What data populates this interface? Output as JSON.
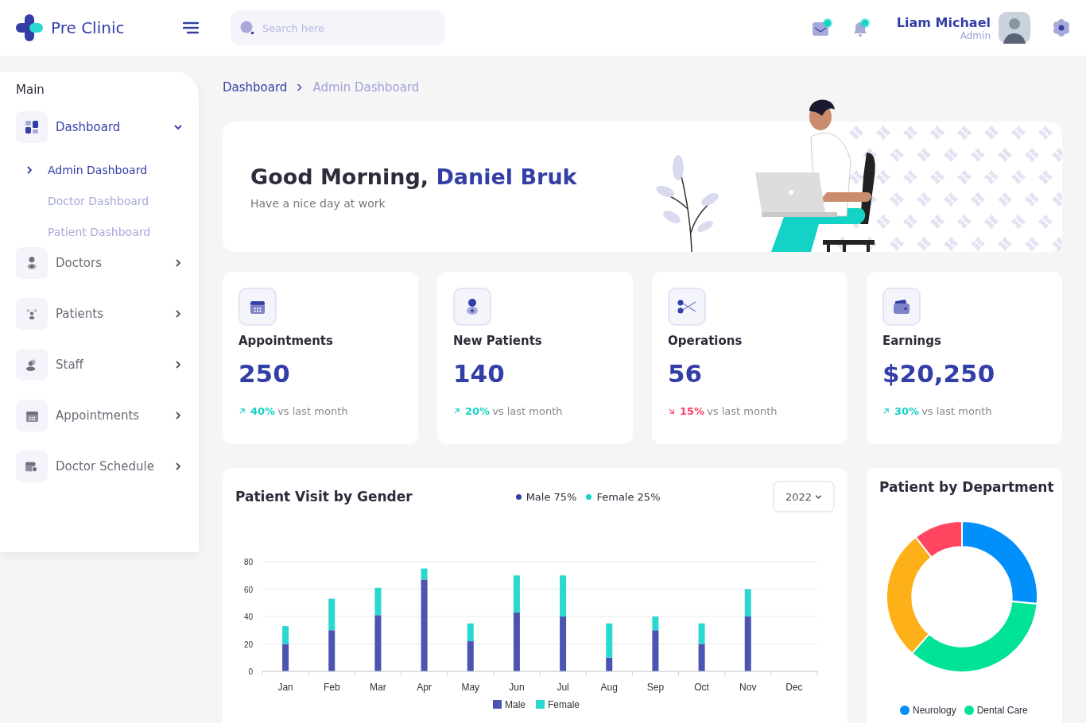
{
  "header": {
    "brand": "Pre Clinic",
    "search": {
      "placeholder": "Search here"
    },
    "user": {
      "name": "Liam Michael",
      "role": "Admin"
    }
  },
  "sidebar": {
    "section": "Main",
    "items": [
      {
        "label": "Dashboard",
        "expanded": true,
        "children": [
          {
            "label": "Admin Dashboard",
            "selected": true
          },
          {
            "label": "Doctor Dashboard",
            "selected": false
          },
          {
            "label": "Patient Dashboard",
            "selected": false
          }
        ]
      },
      {
        "label": "Doctors",
        "expanded": false
      },
      {
        "label": "Patients",
        "expanded": false
      },
      {
        "label": "Staff",
        "expanded": false
      },
      {
        "label": "Appointments",
        "expanded": false
      },
      {
        "label": "Doctor Schedule",
        "expanded": false
      }
    ]
  },
  "breadcrumb": [
    "Dashboard",
    "Admin Dashboard"
  ],
  "greeting": {
    "text": "Good Morning,",
    "name": "Daniel Bruk",
    "subtitle": "Have a nice day at work"
  },
  "stats": [
    {
      "kind": "up",
      "label": "Appointments",
      "value": "250",
      "change": "40%",
      "note": "vs last month"
    },
    {
      "kind": "up",
      "label": "New Patients",
      "value": "140",
      "change": "20%",
      "note": "vs last month"
    },
    {
      "kind": "down",
      "label": "Operations",
      "value": "56",
      "change": "15%",
      "note": "vs last month"
    },
    {
      "kind": "up",
      "label": "Earnings",
      "value": "$20,250",
      "change": "30%",
      "note": "vs last month"
    }
  ],
  "visits": {
    "title": "Patient Visit by Gender",
    "legend": [
      {
        "label": "Male 75%",
        "color": "#333ea6"
      },
      {
        "label": "Female 25%",
        "color": "#15d2c6"
      }
    ],
    "year": "2022",
    "chart_data": {
      "type": "bar",
      "stacked": true,
      "grid": true,
      "legend": true,
      "categories": [
        "Jan",
        "Feb",
        "Mar",
        "Apr",
        "May",
        "Jun",
        "Jul",
        "Aug",
        "Sep",
        "Oct",
        "Nov",
        "Dec"
      ],
      "ylim": [
        0,
        80
      ],
      "yticks": [
        0,
        20,
        40,
        60,
        80
      ],
      "series": [
        {
          "name": "Male",
          "color": "#4c53b1",
          "values": [
            20,
            30,
            41,
            67,
            22,
            43,
            40,
            10,
            30,
            20,
            40,
            null
          ]
        },
        {
          "name": "Female",
          "color": "#2ad8d0",
          "values": [
            13,
            23,
            20,
            8,
            13,
            27,
            30,
            25,
            10,
            15,
            20,
            null
          ]
        }
      ]
    }
  },
  "department": {
    "title": "Patient by Department",
    "legend": [
      {
        "label": "Neurology",
        "color": "#008ffb"
      },
      {
        "label": "Dental Care",
        "color": "#00e396"
      }
    ]
  }
}
